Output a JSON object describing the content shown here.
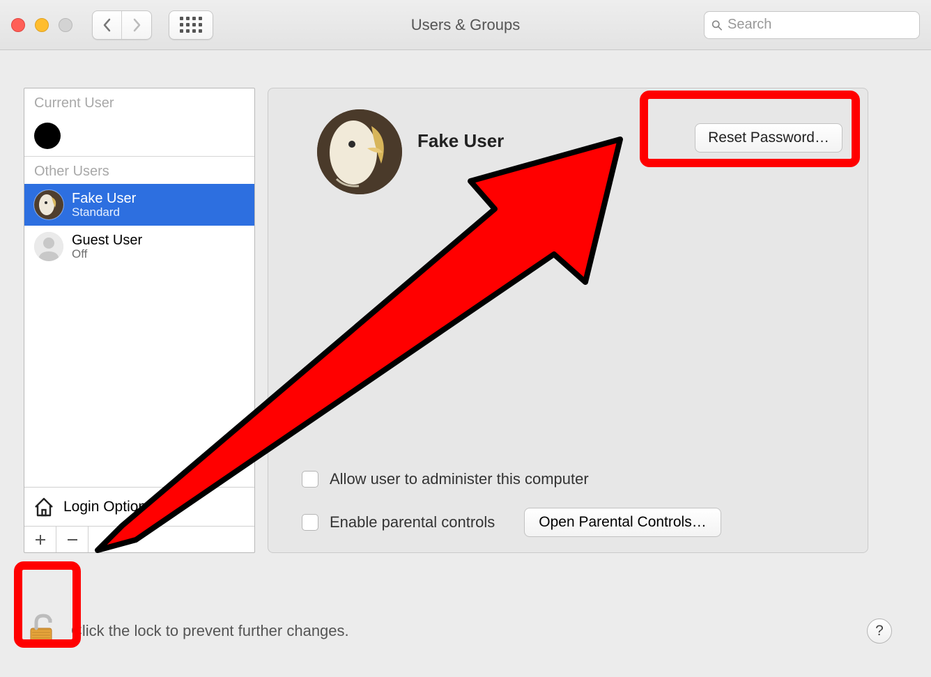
{
  "window": {
    "title": "Users & Groups"
  },
  "search": {
    "placeholder": "Search"
  },
  "sidebar": {
    "current_user_header": "Current User",
    "other_users_header": "Other Users",
    "users": [
      {
        "name": "Fake User",
        "role": "Standard",
        "selected": true
      },
      {
        "name": "Guest User",
        "role": "Off",
        "selected": false
      }
    ],
    "login_options_label": "Login Options"
  },
  "detail": {
    "user_name": "Fake User",
    "reset_password_label": "Reset Password…",
    "allow_admin_label": "Allow user to administer this computer",
    "allow_admin_checked": false,
    "enable_parental_label": "Enable parental controls",
    "enable_parental_checked": false,
    "open_parental_label": "Open Parental Controls…"
  },
  "footer": {
    "lock_text": "Click the lock to prevent further changes.",
    "help_label": "?"
  },
  "colors": {
    "selection_blue": "#2d6fe0",
    "annotation_red": "#ff0000"
  }
}
